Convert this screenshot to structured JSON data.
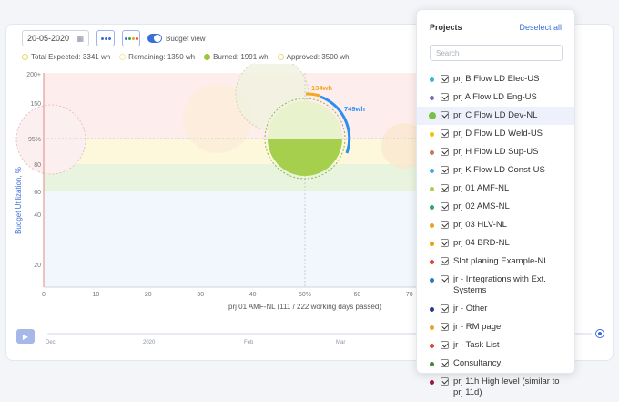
{
  "toolbar": {
    "date": "20-05-2020",
    "budget_view_label": "Budget view",
    "chip1_colors": [
      "#3b6fd8",
      "#3b6fd8",
      "#3b6fd8"
    ],
    "chip2_colors": [
      "#3b6fd8",
      "#2ca84a",
      "#f0a020",
      "#e0453a"
    ]
  },
  "legend": [
    {
      "label": "Total Expected: 3341 wh",
      "color": "#e8d66a"
    },
    {
      "label": "Remaining: 1350 wh",
      "color": "#f2e7a8"
    },
    {
      "label": "Burned: 1991 wh",
      "color": "#9cc43c"
    },
    {
      "label": "Approved: 3500 wh",
      "color": "#f0d28a"
    }
  ],
  "chart_data": {
    "type": "scatter",
    "ylabel": "Budget Utilization, %",
    "xlabel": "prj 01 AMF-NL (111 / 222 working days passed)",
    "y_ticks": [
      "20",
      "40",
      "60",
      "80",
      "95%",
      "150",
      "200+"
    ],
    "x_ticks": [
      "0",
      "10",
      "20",
      "30",
      "40",
      "50%",
      "60",
      "70"
    ],
    "highlight": {
      "x": 50,
      "y": 95,
      "fill": 0.5
    },
    "arc_labels": [
      "134wh",
      "749wh"
    ],
    "colors": {
      "burned": "#a6cf4e",
      "remaining": "#e8f2cc",
      "approved_arc": "#f5a623",
      "expected_arc": "#2a8ff0"
    }
  },
  "timeline": {
    "labels": [
      "Dec",
      "2020",
      "Feb",
      "Mar"
    ]
  },
  "panel": {
    "title": "Projects",
    "deselect_all": "Deselect all",
    "search_placeholder": "Search",
    "items": [
      {
        "label": "prj B Flow LD Elec-US",
        "color": "#36b6d8"
      },
      {
        "label": "prj A Flow LD Eng-US",
        "color": "#7b68c8"
      },
      {
        "label": "prj C Flow LD Dev-NL",
        "color": "#7ac142",
        "selected": true
      },
      {
        "label": "prj D Flow LD Weld-US",
        "color": "#f2c200"
      },
      {
        "label": "prj H Flow LD Sup-US",
        "color": "#c27a5a"
      },
      {
        "label": "prj K Flow LD Const-US",
        "color": "#4aa8e8"
      },
      {
        "label": "prj 01 AMF-NL",
        "color": "#a6cf4e"
      },
      {
        "label": "prj 02 AMS-NL",
        "color": "#2aa868"
      },
      {
        "label": "prj 03 HLV-NL",
        "color": "#f0a020"
      },
      {
        "label": "prj 04 BRD-NL",
        "color": "#f2a000"
      },
      {
        "label": "Slot planing Example-NL",
        "color": "#e0453a"
      },
      {
        "label": "jr - Integrations with Ext. Systems",
        "color": "#2a7ab8"
      },
      {
        "label": "jr - Other",
        "color": "#243a8c"
      },
      {
        "label": "jr - RM page",
        "color": "#f0a020"
      },
      {
        "label": "jr - Task List",
        "color": "#e0453a"
      },
      {
        "label": "Consultancy",
        "color": "#3a8a3a"
      },
      {
        "label": "prj 11h High level (similar to prj 11d)",
        "color": "#a0153e"
      }
    ]
  }
}
